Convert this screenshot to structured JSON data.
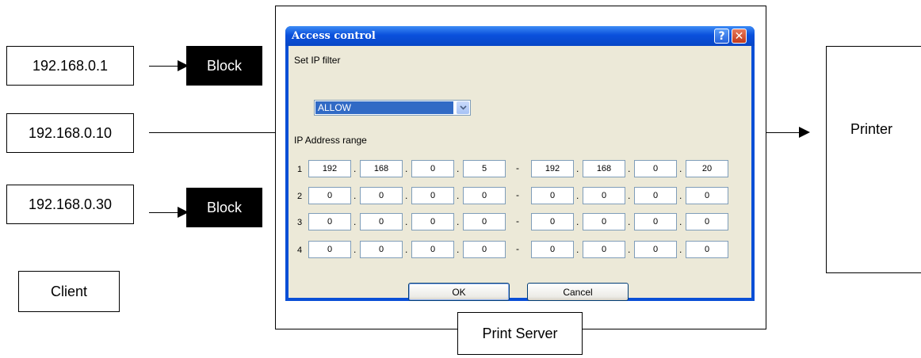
{
  "diagram": {
    "clients": [
      "192.168.0.1",
      "192.168.0.10",
      "192.168.0.30"
    ],
    "client_label": "Client",
    "block_labels": [
      "Block",
      "Block"
    ],
    "printer_label": "Printer",
    "server_label": "Print Server"
  },
  "dialog": {
    "title": "Access control",
    "help_label": "?",
    "close_label": "✕",
    "filter_label": "Set IP filter",
    "filter_value": "ALLOW",
    "range_label": "IP Address range",
    "rows": [
      {
        "num": "1",
        "from": [
          "192",
          "168",
          "0",
          "5"
        ],
        "to": [
          "192",
          "168",
          "0",
          "20"
        ]
      },
      {
        "num": "2",
        "from": [
          "0",
          "0",
          "0",
          "0"
        ],
        "to": [
          "0",
          "0",
          "0",
          "0"
        ]
      },
      {
        "num": "3",
        "from": [
          "0",
          "0",
          "0",
          "0"
        ],
        "to": [
          "0",
          "0",
          "0",
          "0"
        ]
      },
      {
        "num": "4",
        "from": [
          "0",
          "0",
          "0",
          "0"
        ],
        "to": [
          "0",
          "0",
          "0",
          "0"
        ]
      }
    ],
    "ok_label": "OK",
    "cancel_label": "Cancel"
  }
}
